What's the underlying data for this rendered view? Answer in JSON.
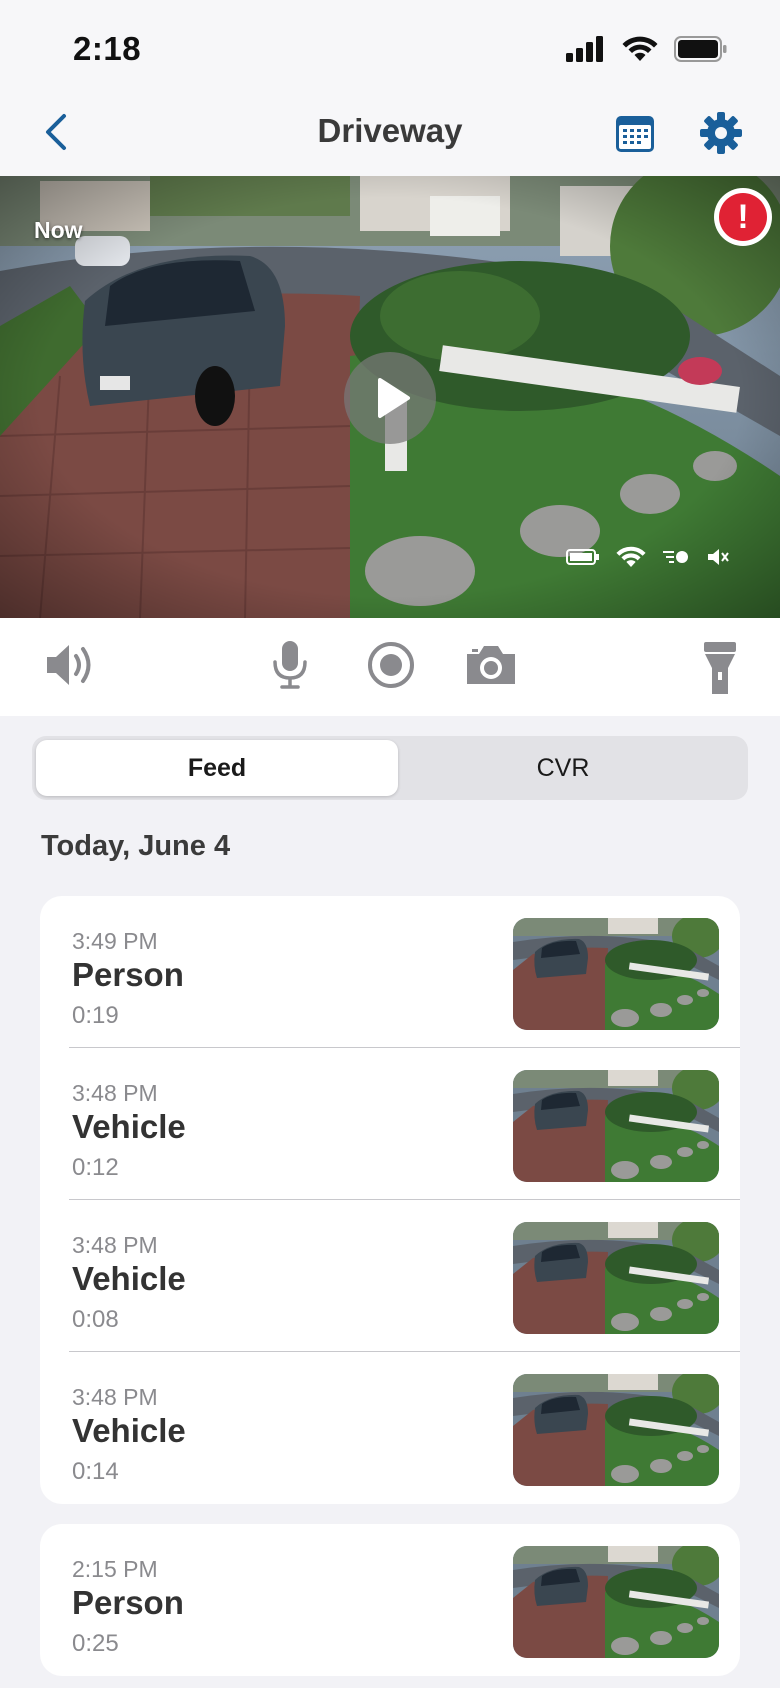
{
  "status_bar": {
    "time": "2:18"
  },
  "nav": {
    "title": "Driveway"
  },
  "video": {
    "now_label": "Now",
    "alert_symbol": "!"
  },
  "controls": [
    "speaker-icon",
    "microphone-icon",
    "record-icon",
    "camera-icon",
    "flashlight-icon"
  ],
  "tabs": {
    "feed": "Feed",
    "cvr": "CVR",
    "selected": "Feed"
  },
  "date_header": "Today, June 4",
  "event_groups": [
    {
      "events": [
        {
          "time": "3:49 PM",
          "type": "Person",
          "duration": "0:19"
        },
        {
          "time": "3:48 PM",
          "type": "Vehicle",
          "duration": "0:12"
        },
        {
          "time": "3:48 PM",
          "type": "Vehicle",
          "duration": "0:08"
        },
        {
          "time": "3:48 PM",
          "type": "Vehicle",
          "duration": "0:14"
        }
      ]
    },
    {
      "events": [
        {
          "time": "2:15 PM",
          "type": "Person",
          "duration": "0:25"
        }
      ]
    }
  ],
  "colors": {
    "accent": "#1a5f9a",
    "alert": "#e02234",
    "background": "#f2f2f6"
  }
}
